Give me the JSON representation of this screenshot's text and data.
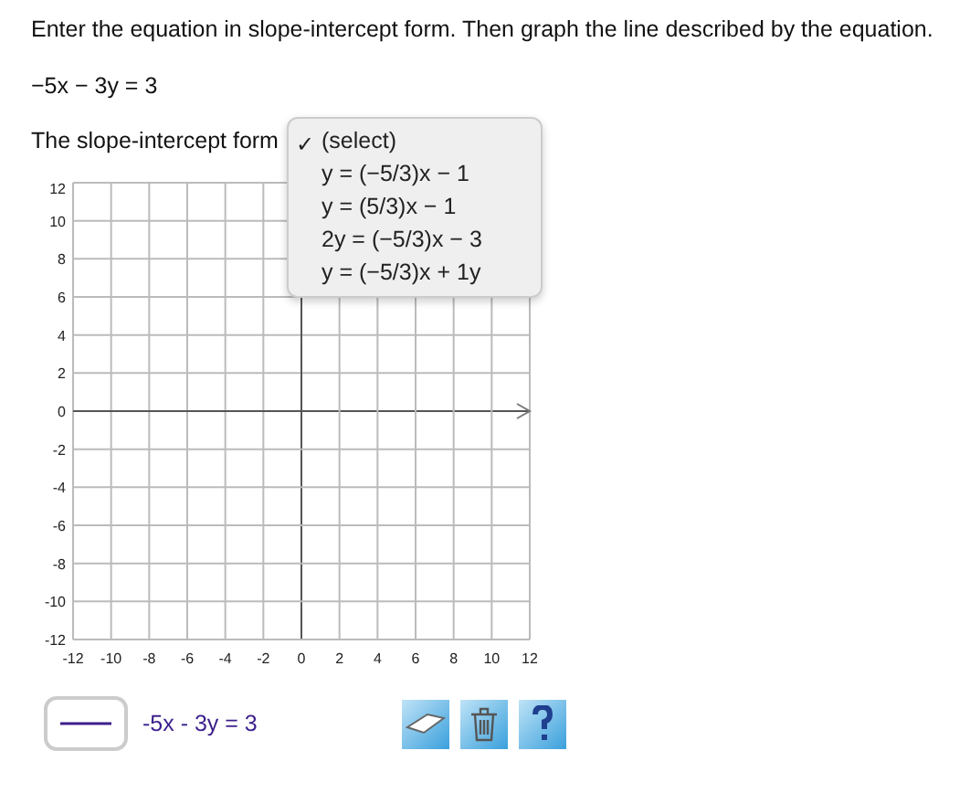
{
  "instructions": "Enter the equation in slope-intercept form. Then graph the line described by the equation.",
  "equation": "−5x − 3y = 3",
  "answer": {
    "label": "The slope-intercept form",
    "check_mark": "✓",
    "options": [
      {
        "text": "(select)",
        "selected": true
      },
      {
        "text": "y = (−5/3)x − 1",
        "selected": false
      },
      {
        "text": "y = (5/3)x − 1",
        "selected": false
      },
      {
        "text": "2y = (−5/3)x − 3",
        "selected": false
      },
      {
        "text": "y = (−5/3)x + 1y",
        "selected": false
      }
    ]
  },
  "graph": {
    "x_ticks": [
      "-12",
      "-10",
      "-8",
      "-6",
      "-4",
      "-2",
      "0",
      "2",
      "4",
      "6",
      "8",
      "10",
      "12"
    ],
    "y_ticks": [
      "12",
      "10",
      "8",
      "6",
      "4",
      "2",
      "0",
      "-2",
      "-4",
      "-6",
      "-8",
      "-10",
      "-12"
    ]
  },
  "legend": {
    "label": "-5x - 3y = 3"
  },
  "tools": [
    {
      "kind": "eraser"
    },
    {
      "kind": "trash"
    },
    {
      "kind": "help"
    }
  ]
}
